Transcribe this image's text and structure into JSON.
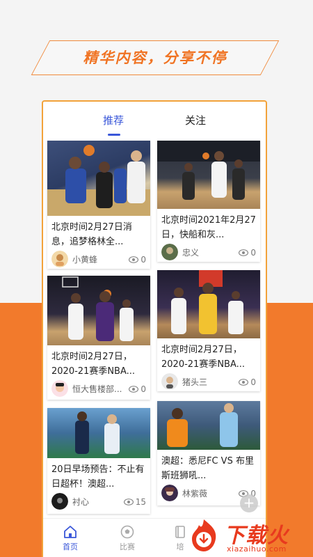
{
  "banner": {
    "text": "精华内容，分享不停"
  },
  "tabs": [
    {
      "label": "推荐"
    },
    {
      "label": "关注"
    }
  ],
  "feed": [
    {
      "title": "北京时间2月27日消息，追梦格林全...",
      "author": "小黄蜂",
      "views": "0"
    },
    {
      "title": "北京时间2021年2月27日，快船和灰...",
      "author": "忠义",
      "views": "0"
    },
    {
      "title": "北京时间2月27日，2020-21赛季NBA...",
      "author": "恒大售楼部...",
      "views": "0"
    },
    {
      "title": "北京时间2月27日，2020-21赛季NBA...",
      "author": "猪头三",
      "views": "0"
    },
    {
      "title": "20日早场预告：不止有日超杯！澳超...",
      "author": "衬心",
      "views": "15"
    },
    {
      "title": "澳超：悉尼FC VS 布里斯班狮吼...",
      "author": "林紫薇",
      "views": "0"
    }
  ],
  "nav": [
    {
      "label": "首页"
    },
    {
      "label": "比赛"
    },
    {
      "label": "培"
    }
  ],
  "fab": {
    "label": "+"
  },
  "watermark": {
    "title": "下载火",
    "url": "xiazaihuo.com"
  },
  "colors": {
    "accent": "#3a57d9",
    "brand_orange": "#f27a2c",
    "border": "#f2a23a"
  }
}
